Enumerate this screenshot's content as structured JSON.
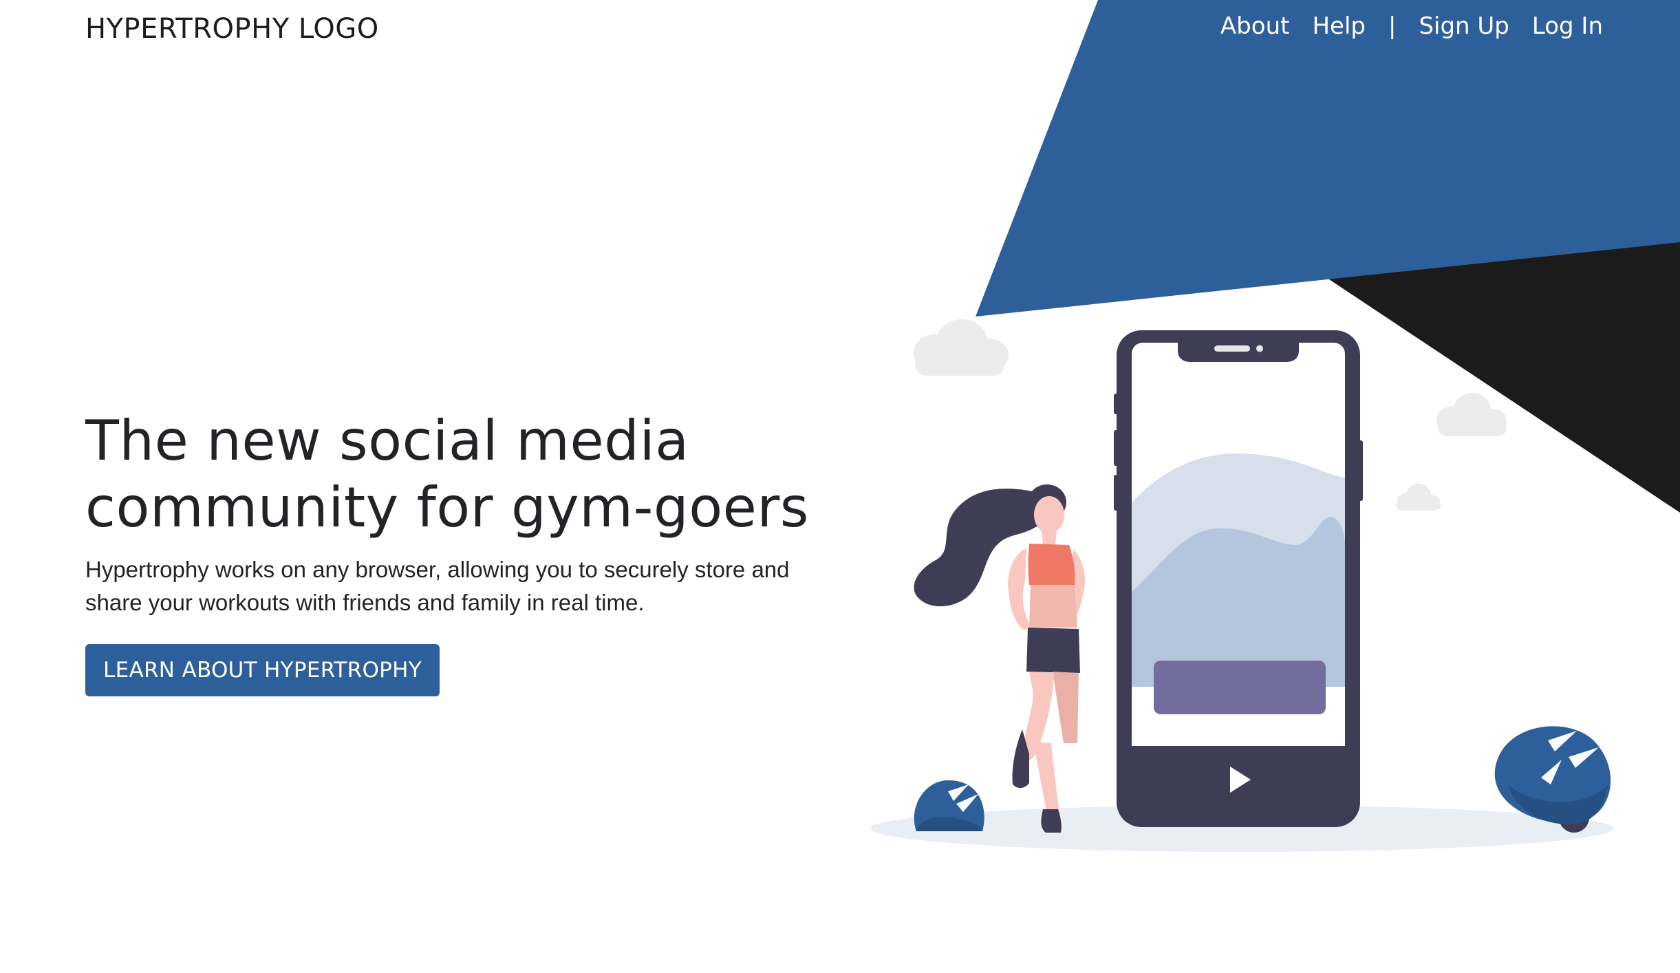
{
  "header": {
    "logo_text": "HYPERTROPHY LOGO"
  },
  "nav": {
    "about": "About",
    "help": "Help",
    "divider": "|",
    "sign_up": "Sign Up",
    "log_in": "Log In"
  },
  "hero": {
    "title_line1": "The new social media",
    "title_line2": "community for gym-goers",
    "description": "Hypertrophy works on any browser, allowing you to securely store and share your workouts with friends and family in real time.",
    "cta_label": "LEARN ABOUT HYPERTROPHY"
  },
  "colors": {
    "brand_blue": "#2d5f9b",
    "dark_triangle": "#1b1b1b",
    "phone_body": "#3f3d56",
    "accent_coral": "#f07866",
    "phone_button_purple": "#726d9c",
    "text_dark": "#222326"
  },
  "icons": {
    "play": "play-icon",
    "clouds": "cloud-icon",
    "bushes": "bush-icon"
  }
}
